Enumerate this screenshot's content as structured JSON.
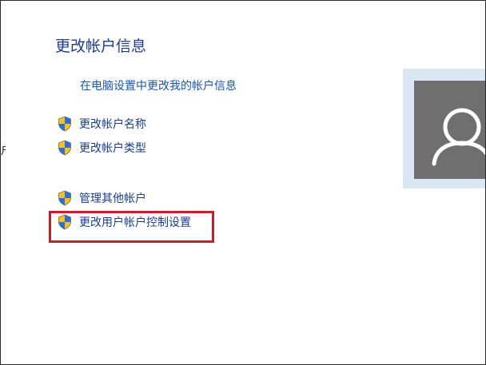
{
  "page": {
    "left_cut_text": "户",
    "title": "更改帐户信息",
    "pc_settings_link": "在电脑设置中更改我的帐户信息"
  },
  "tasks": [
    {
      "label": "更改帐户名称",
      "icon": "uac-shield-icon"
    },
    {
      "label": "更改帐户类型",
      "icon": "uac-shield-icon"
    },
    {
      "label": "管理其他帐户",
      "icon": "uac-shield-icon"
    },
    {
      "label": "更改用户帐户控制设置",
      "icon": "uac-shield-icon"
    }
  ],
  "highlight_color": "#c8202a",
  "avatar": {
    "icon": "user-avatar-icon",
    "bg": "#6f6f6f"
  }
}
